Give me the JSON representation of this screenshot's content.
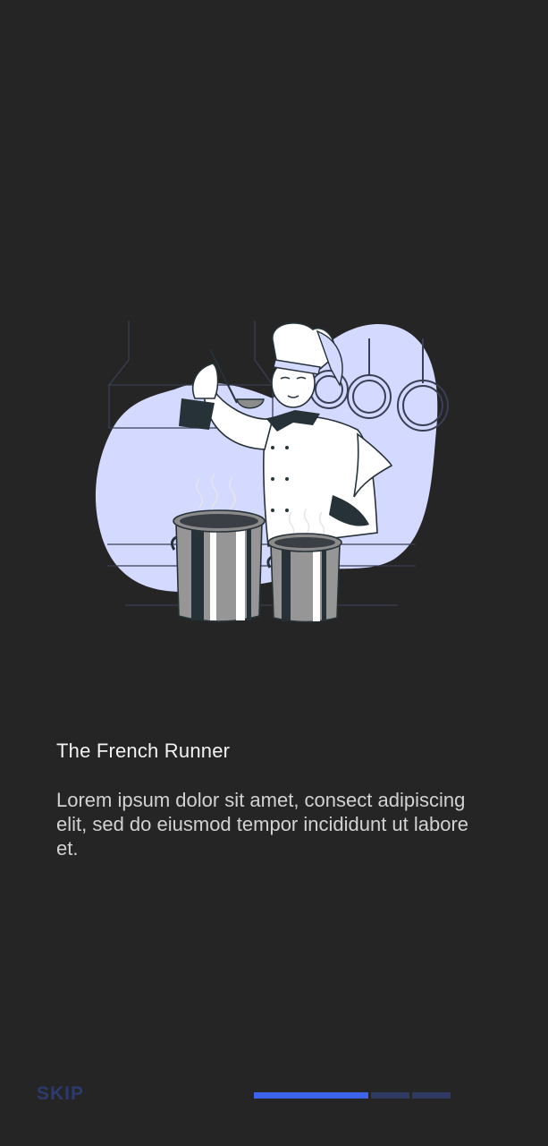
{
  "onboarding": {
    "title": "The French Runner",
    "description": "Lorem ipsum dolor sit amet, consect adipiscing elit, sed do eiusmod tempor incididunt ut labore et.",
    "illustration_icon": "chef-cooking-illustration"
  },
  "footer": {
    "skip_label": "SKIP",
    "page_indicator": {
      "current_page": 1,
      "total_pages": 3
    }
  },
  "colors": {
    "background": "#252525",
    "accent": "#3d63ea",
    "indicator_inactive": "#2e3a61",
    "skip_text": "#2c3a6e",
    "illustration_blob": "#d3d9ff"
  }
}
